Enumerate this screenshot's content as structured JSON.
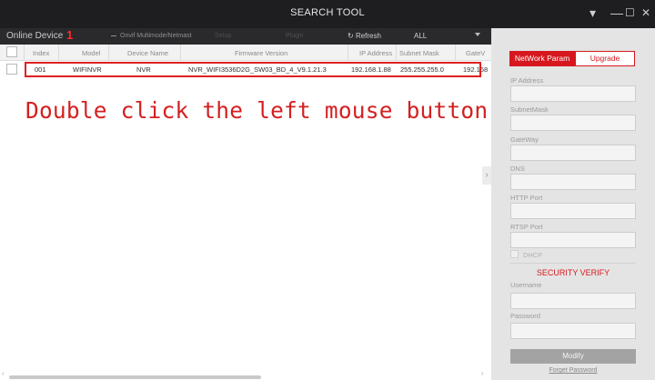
{
  "window": {
    "title": "SEARCH TOOL",
    "controls": [
      "▾",
      "—",
      "☐",
      "✕"
    ]
  },
  "toolbar": {
    "online_label": "Online Device",
    "device_count": "1",
    "onvif_label": "Onvif Multimode/Netmast",
    "faint_items": [
      "Setup",
      "Plugin"
    ],
    "refresh_label": "Refresh",
    "filter_value": "ALL"
  },
  "table": {
    "columns": [
      "Index",
      "Model",
      "Device Name",
      "Firmware Version",
      "IP Address",
      "Subnet Mask",
      "GateV"
    ],
    "rows": [
      {
        "index": "001",
        "model": "WIFINVR",
        "device_name": "NVR",
        "firmware": "NVR_WIFI3536D2G_SW03_BD_4_V9.1.21.3",
        "ip": "192.168.1.88",
        "mask": "255.255.255.0",
        "gateway": "192.168"
      }
    ]
  },
  "annotation": {
    "text": "Double click the left mouse button",
    "color": "#d42020"
  },
  "panel": {
    "tabs": {
      "network": "NetWork Param",
      "upgrade": "Upgrade"
    },
    "fields": {
      "ip": {
        "label": "IP Address",
        "value": ""
      },
      "mask": {
        "label": "SubnetMask",
        "value": ""
      },
      "gateway": {
        "label": "GateWay",
        "value": ""
      },
      "dns": {
        "label": "DNS",
        "value": ""
      },
      "http": {
        "label": "HTTP Port",
        "value": ""
      },
      "rtsp": {
        "label": "RTSP Port",
        "value": ""
      },
      "username": {
        "label": "Username",
        "value": ""
      },
      "password": {
        "label": "Password",
        "value": ""
      }
    },
    "dhcp_label": "DHCP",
    "security_title": "SECURITY VERIFY",
    "modify_label": "Modify",
    "forgot_label": "Forget Password"
  },
  "colors": {
    "accent": "#d6181e",
    "titlebar": "#1e1e20",
    "toolbar": "#2a2a2c",
    "panel_bg": "#e4e4e4"
  },
  "icons": [
    "refresh-icon",
    "collapse-arrow-icon",
    "dropdown-arrow-icon"
  ]
}
